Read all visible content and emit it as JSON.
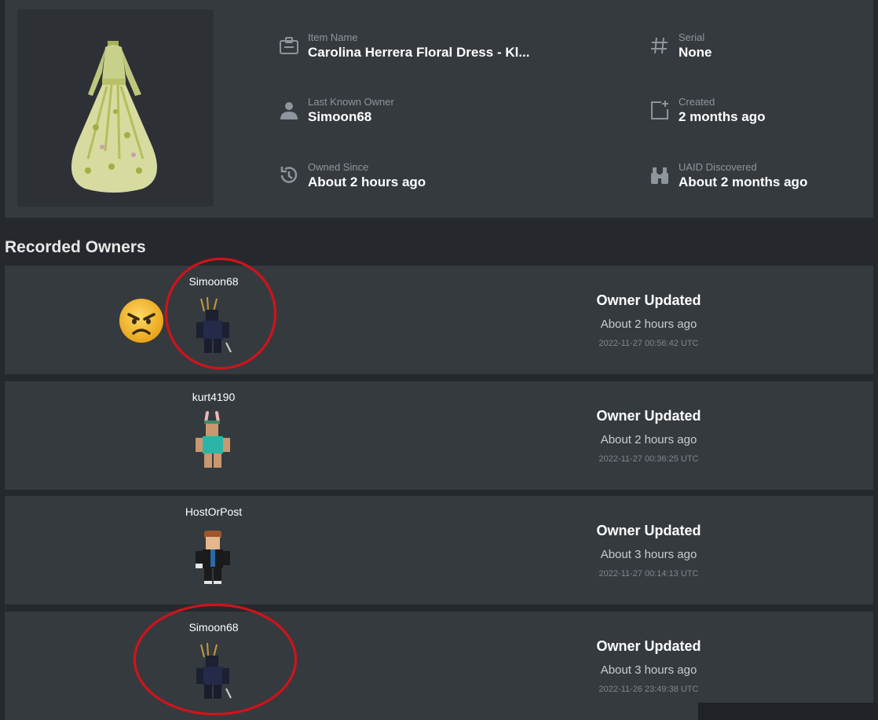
{
  "item": {
    "fields": {
      "item_name": {
        "label": "Item Name",
        "value": "Carolina Herrera Floral Dress - Kl..."
      },
      "serial": {
        "label": "Serial",
        "value": "None"
      },
      "last_owner": {
        "label": "Last Known Owner",
        "value": "Simoon68"
      },
      "created": {
        "label": "Created",
        "value": "2 months ago"
      },
      "owned_since": {
        "label": "Owned Since",
        "value": "About 2 hours ago"
      },
      "uaid_discovered": {
        "label": "UAID Discovered",
        "value": "About 2 months ago"
      }
    }
  },
  "owners_section": {
    "title": "Recorded Owners",
    "rows": [
      {
        "username": "Simoon68",
        "event": "Owner Updated",
        "relative": "About 2 hours ago",
        "timestamp": "2022-11-27 00:56:42 UTC"
      },
      {
        "username": "kurt4190",
        "event": "Owner Updated",
        "relative": "About 2 hours ago",
        "timestamp": "2022-11-27 00:36:25 UTC"
      },
      {
        "username": "HostOrPost",
        "event": "Owner Updated",
        "relative": "About 3 hours ago",
        "timestamp": "2022-11-27 00:14:13 UTC"
      },
      {
        "username": "Simoon68",
        "event": "Owner Updated",
        "relative": "About 3 hours ago",
        "timestamp": "2022-11-26 23:49:38 UTC"
      }
    ]
  },
  "colors": {
    "page_bg": "#25282c",
    "card_bg": "#353a3f",
    "annotation_red": "#d0141a"
  },
  "icons": [
    "id-card-icon",
    "hash-icon",
    "person-icon",
    "calendar-plus-icon",
    "history-icon",
    "binoculars-icon",
    "angry-face-emoji"
  ]
}
